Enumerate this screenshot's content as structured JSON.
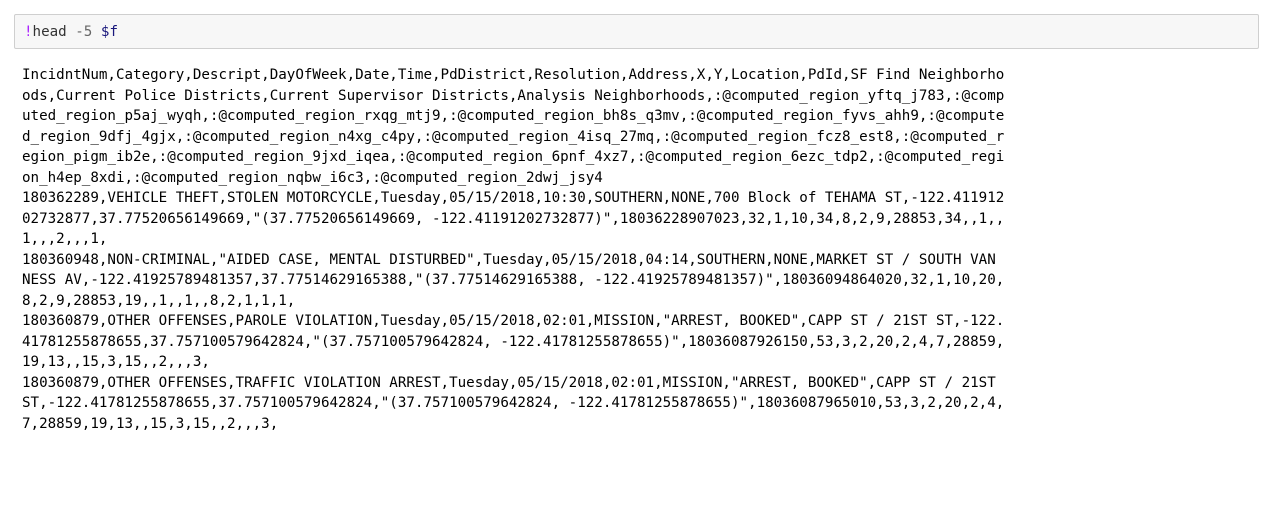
{
  "cell": {
    "command": {
      "op": "!",
      "program": "head ",
      "flag": "-5",
      "space": " ",
      "var": "$f"
    },
    "output_lines": [
      "IncidntNum,Category,Descript,DayOfWeek,Date,Time,PdDistrict,Resolution,Address,X,Y,Location,PdId,SF Find Neighborho",
      "ods,Current Police Districts,Current Supervisor Districts,Analysis Neighborhoods,:@computed_region_yftq_j783,:@comp",
      "uted_region_p5aj_wyqh,:@computed_region_rxqg_mtj9,:@computed_region_bh8s_q3mv,:@computed_region_fyvs_ahh9,:@compute",
      "d_region_9dfj_4gjx,:@computed_region_n4xg_c4py,:@computed_region_4isq_27mq,:@computed_region_fcz8_est8,:@computed_r",
      "egion_pigm_ib2e,:@computed_region_9jxd_iqea,:@computed_region_6pnf_4xz7,:@computed_region_6ezc_tdp2,:@computed_regi",
      "on_h4ep_8xdi,:@computed_region_nqbw_i6c3,:@computed_region_2dwj_jsy4",
      "180362289,VEHICLE THEFT,STOLEN MOTORCYCLE,Tuesday,05/15/2018,10:30,SOUTHERN,NONE,700 Block of TEHAMA ST,-122.411912",
      "02732877,37.77520656149669,\"(37.77520656149669, -122.41191202732877)\",18036228907023,32,1,10,34,8,2,9,28853,34,,1,,",
      "1,,,2,,,1,",
      "180360948,NON-CRIMINAL,\"AIDED CASE, MENTAL DISTURBED\",Tuesday,05/15/2018,04:14,SOUTHERN,NONE,MARKET ST / SOUTH VAN",
      "NESS AV,-122.41925789481357,37.77514629165388,\"(37.77514629165388, -122.41925789481357)\",18036094864020,32,1,10,20,",
      "8,2,9,28853,19,,1,,1,,8,2,1,1,1,",
      "180360879,OTHER OFFENSES,PAROLE VIOLATION,Tuesday,05/15/2018,02:01,MISSION,\"ARREST, BOOKED\",CAPP ST / 21ST ST,-122.",
      "41781255878655,37.757100579642824,\"(37.757100579642824, -122.41781255878655)\",18036087926150,53,3,2,20,2,4,7,28859,",
      "19,13,,15,3,15,,2,,,3,",
      "180360879,OTHER OFFENSES,TRAFFIC VIOLATION ARREST,Tuesday,05/15/2018,02:01,MISSION,\"ARREST, BOOKED\",CAPP ST / 21ST",
      "ST,-122.41781255878655,37.757100579642824,\"(37.757100579642824, -122.41781255878655)\",18036087965010,53,3,2,20,2,4,",
      "7,28859,19,13,,15,3,15,,2,,,3,"
    ]
  }
}
